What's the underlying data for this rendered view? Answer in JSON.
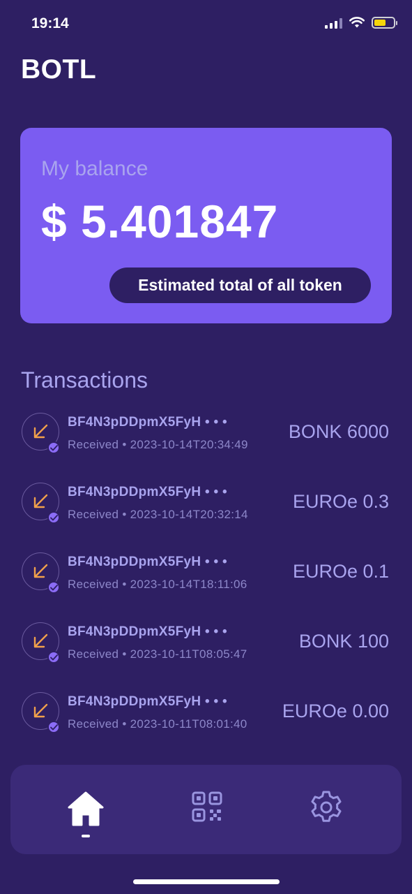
{
  "status_bar": {
    "time": "19:14",
    "signal_icon": "signal-icon",
    "wifi_icon": "wifi-icon",
    "battery_icon": "battery-icon",
    "battery_color": "#f5d60a"
  },
  "app": {
    "title": "BOTL"
  },
  "balance": {
    "label": "My balance",
    "amount": "$ 5.401847",
    "estimate_label": "Estimated total of all token",
    "card_color": "#7b5cf1"
  },
  "transactions": {
    "heading": "Transactions",
    "items": [
      {
        "address": "BF4N3pDDpmX5FyH • • •",
        "status": "Received",
        "timestamp": "2023-10-14T20:34:49",
        "amount": "BONK 6000"
      },
      {
        "address": "BF4N3pDDpmX5FyH • • •",
        "status": "Received",
        "timestamp": "2023-10-14T20:32:14",
        "amount": "EUROe 0.3"
      },
      {
        "address": "BF4N3pDDpmX5FyH • • •",
        "status": "Received",
        "timestamp": "2023-10-14T18:11:06",
        "amount": "EUROe 0.1"
      },
      {
        "address": "BF4N3pDDpmX5FyH • • •",
        "status": "Received",
        "timestamp": "2023-10-11T08:05:47",
        "amount": "BONK 100"
      },
      {
        "address": "BF4N3pDDpmX5FyH • • •",
        "status": "Received",
        "timestamp": "2023-10-11T08:01:40",
        "amount": "EUROe 0.00"
      }
    ],
    "icon": "arrow-down-left-icon",
    "icon_color": "#f0a04b"
  },
  "bottom_nav": {
    "items": [
      {
        "name": "home",
        "icon": "home-icon",
        "active": true
      },
      {
        "name": "qr",
        "icon": "qr-code-icon",
        "active": false
      },
      {
        "name": "settings",
        "icon": "gear-icon",
        "active": false
      }
    ]
  }
}
